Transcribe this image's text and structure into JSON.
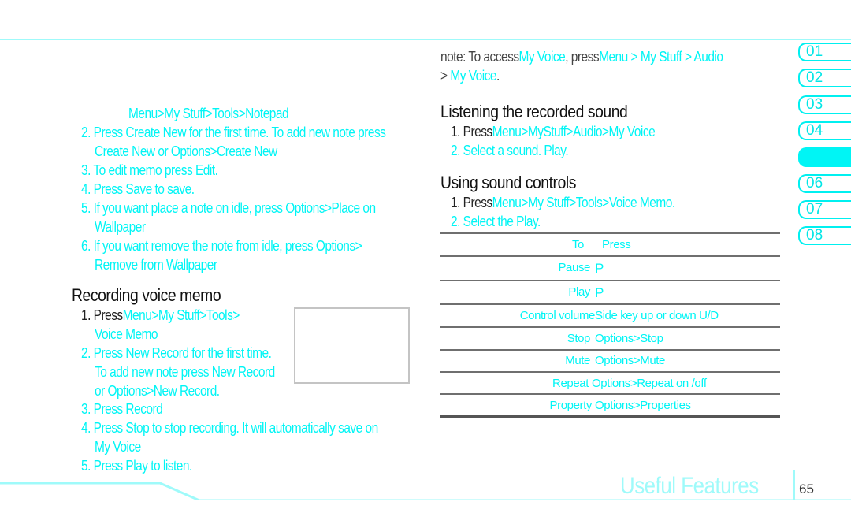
{
  "colors": {
    "accent": "#00f5f5",
    "accent_light": "#9ffafa",
    "text": "#222222",
    "rule": "#6f6f6f",
    "image_border": "#c4c4c4"
  },
  "left": {
    "notepad_path": "Menu>My Stuff>Tools>Notepad",
    "notepad_steps": [
      {
        "line1": "2. Press Create New for the first time. To add new note press",
        "line2": "Create New or Options>Create New"
      },
      {
        "line1": "3. To edit memo press Edit."
      },
      {
        "line1": "4. Press Save to save."
      },
      {
        "line1": "5. If you want place a note on idle, press Options>Place on",
        "line2": "Wallpaper"
      },
      {
        "line1": "6. If you want remove the note from idle, press Options>",
        "line2": "Remove from Wallpaper"
      }
    ],
    "recording_heading": "Recording voice memo",
    "recording_steps": {
      "s1_prefix": "1. Press",
      "s1_path": "Menu>My Stuff>Tools>",
      "s1_line2": "Voice Memo",
      "s2_line1": "2. Press New Record for the first time.",
      "s2_line2": "To add new note press New Record",
      "s2_line3": "or Options>New Record.",
      "s3": "3. Press Record",
      "s4_line1": "4. Press Stop to stop recording. It will automatically save on",
      "s4_line2": "My Voice",
      "s5": "5. Press Play to listen."
    }
  },
  "right": {
    "note": {
      "prefix": "note:  To access",
      "link1": "My Voice",
      "mid": ", press",
      "path": "Menu > My Stuff > Audio",
      "line2_prefix": "> ",
      "line2_link": "My Voice",
      "line2_suffix": "."
    },
    "listening_heading": "Listening the recorded sound",
    "listening_steps": {
      "s1_prefix": "1. Press",
      "s1_path": "Menu>MyStuff>Audio>My Voice",
      "s2": "2. Select a sound. Play."
    },
    "controls_heading": "Using sound controls",
    "controls_steps": {
      "s1_prefix": "1. Press",
      "s1_path": "Menu>My Stuff>Tools>Voice Memo.",
      "s2": "2. Select the Play."
    },
    "table": {
      "headers": {
        "to": "To",
        "press": "Press"
      },
      "rows": [
        {
          "to": "Pause",
          "press": "P"
        },
        {
          "to": "Play",
          "press": "P"
        },
        {
          "to": "Control volume",
          "press": "Side key up or down U/D"
        },
        {
          "to": "Stop",
          "press": "Options>Stop"
        },
        {
          "to": "Mute",
          "press": "Options>Mute"
        },
        {
          "to": "Repeat",
          "press": "Options>Repeat on /off"
        },
        {
          "to": "Property",
          "press": "Options>Properties"
        }
      ]
    }
  },
  "chapters": [
    {
      "label": "01",
      "active": false
    },
    {
      "label": "02",
      "active": false
    },
    {
      "label": "03",
      "active": false
    },
    {
      "label": "04",
      "active": false
    },
    {
      "label": "",
      "active": true
    },
    {
      "label": "06",
      "active": false
    },
    {
      "label": "07",
      "active": false
    },
    {
      "label": "08",
      "active": false
    }
  ],
  "footer": {
    "section_title": "Useful Features",
    "page_number": "65"
  }
}
